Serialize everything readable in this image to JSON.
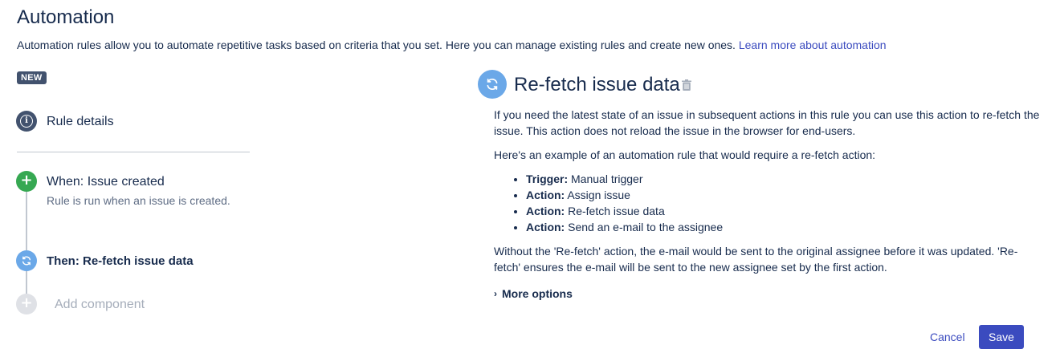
{
  "header": {
    "title": "Automation",
    "intro_text": "Automation rules allow you to automate repetitive tasks based on criteria that you set. Here you can manage existing rules and create new ones. ",
    "intro_link": "Learn more about automation"
  },
  "steps": {
    "badge": "NEW",
    "rule_details": "Rule details",
    "when_label": "When: Issue created",
    "when_desc": "Rule is run when an issue is created.",
    "then_label": "Then: Re-fetch issue data",
    "add_component": "Add component"
  },
  "detail": {
    "title": "Re-fetch issue data",
    "para1": "If you need the latest state of an issue in subsequent actions in this rule you can use this action to re-fetch the issue. This action does not reload the issue in the browser for end-users.",
    "para2": "Here's an example of an automation rule that would require a re-fetch action:",
    "list": [
      {
        "key": "Trigger:",
        "value": " Manual trigger"
      },
      {
        "key": "Action:",
        "value": " Assign issue"
      },
      {
        "key": "Action:",
        "value": " Re-fetch issue data"
      },
      {
        "key": "Action:",
        "value": " Send an e-mail to the assignee"
      }
    ],
    "para3": "Without the 'Re-fetch' action, the e-mail would be sent to the original assignee before it was updated. 'Re-fetch' ensures the e-mail will be sent to the new assignee set by the first action.",
    "more_options": "More options"
  },
  "actions": {
    "cancel": "Cancel",
    "save": "Save"
  },
  "colors": {
    "accent": "#3b4bbf",
    "trigger_green": "#36a852",
    "action_blue": "#6ba8e8",
    "info_dark": "#42526e"
  },
  "icons": [
    "info-icon",
    "plus-icon",
    "refresh-icon",
    "trash-icon",
    "chevron-right-icon"
  ]
}
